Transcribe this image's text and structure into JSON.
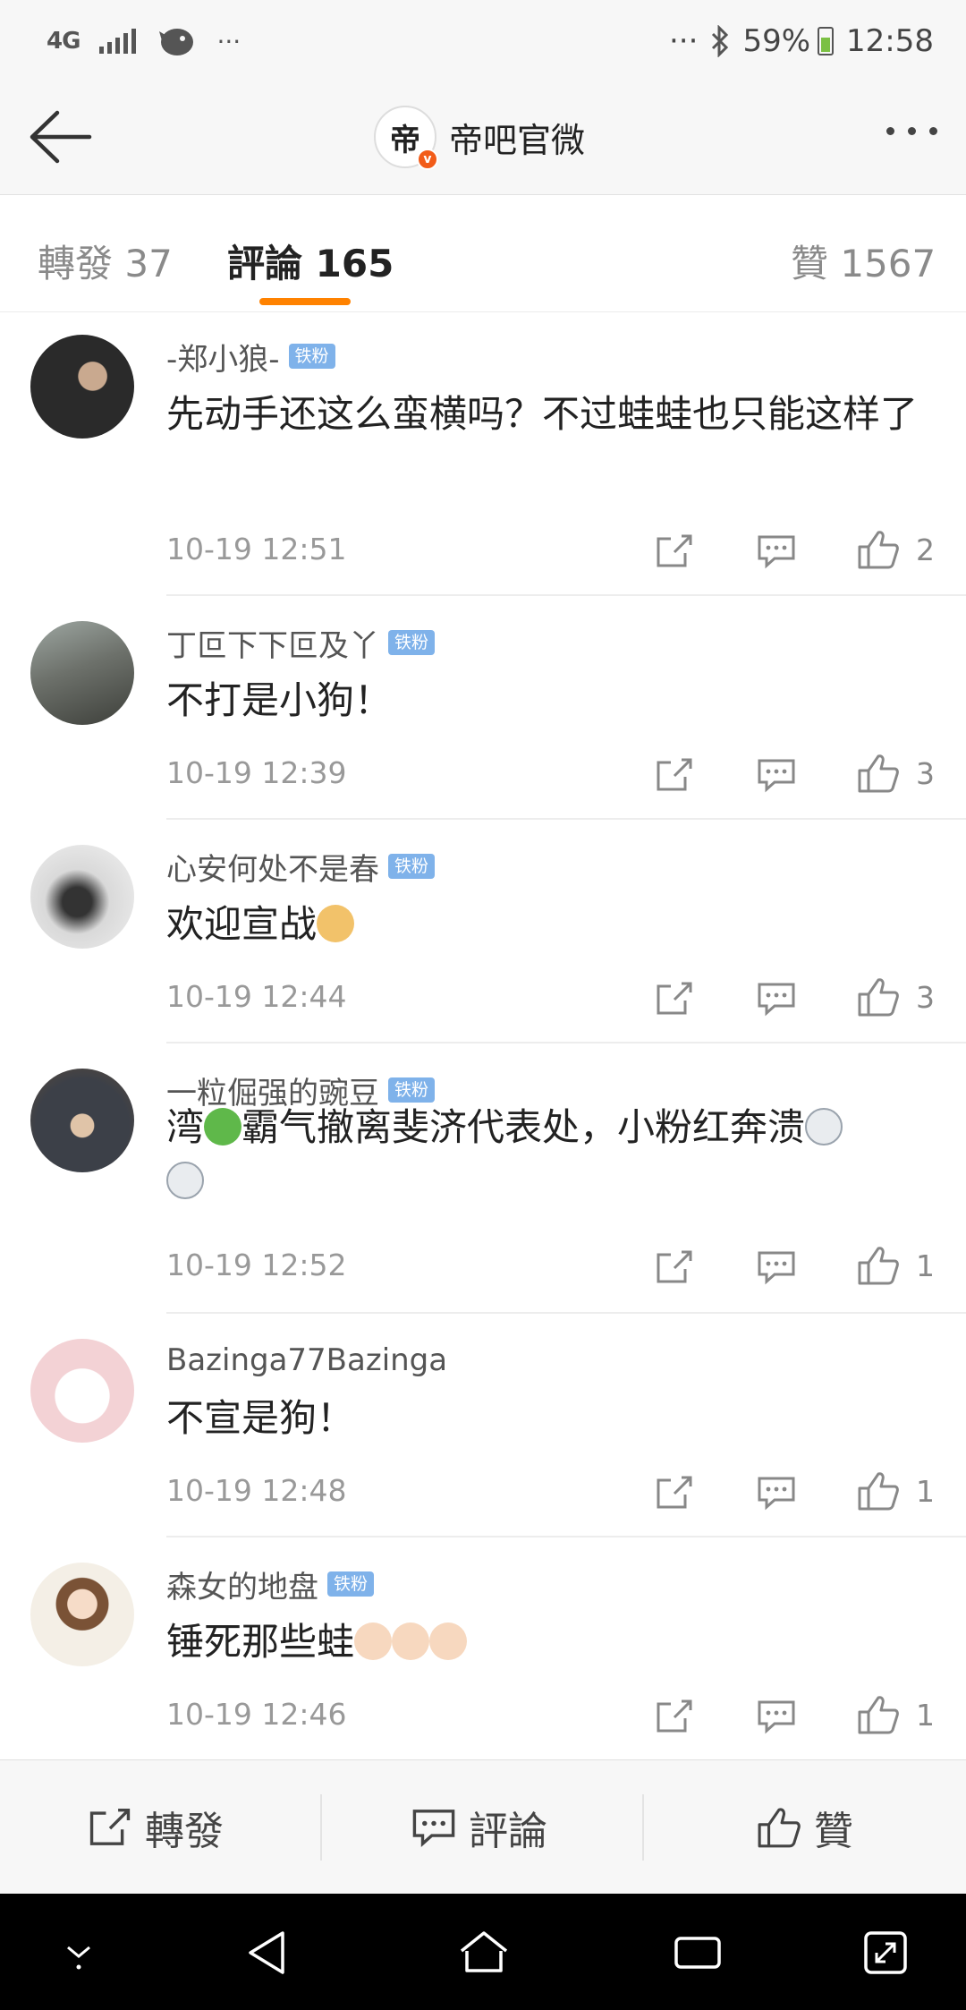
{
  "status_bar": {
    "network": "4G",
    "dots_left": "···",
    "dots_right": "···",
    "battery": "59%",
    "time": "12:58"
  },
  "header": {
    "avatar_char": "帝",
    "title": "帝吧官微"
  },
  "tabs": [
    {
      "label": "轉發 37"
    },
    {
      "label": "評論 165"
    },
    {
      "label": "贊 1567"
    }
  ],
  "comments": [
    {
      "name": "-郑小狼-",
      "badge": "铁粉",
      "text": "先动手还这么蛮横吗？不过蛙蛙也只能这样了",
      "time": "10-19 12:51",
      "likes": "2"
    },
    {
      "name": "丁叵下下叵及丫",
      "badge": "铁粉",
      "text": "不打是小狗！",
      "time": "10-19 12:39",
      "likes": "3"
    },
    {
      "name": "心安何处不是春",
      "badge": "铁粉",
      "text": "欢迎宣战",
      "time": "10-19 12:44",
      "likes": "3"
    },
    {
      "name": "一粒倔强的豌豆",
      "badge": "铁粉",
      "text_a": "湾",
      "text_b": "霸气撤离斐济代表处，小粉红奔溃",
      "time": "10-19 12:52",
      "likes": "1"
    },
    {
      "name": "Bazinga77Bazinga",
      "badge": "",
      "text": "不宣是狗！",
      "time": "10-19 12:48",
      "likes": "1"
    },
    {
      "name": "森女的地盘",
      "badge": "铁粉",
      "text": "锤死那些蛙",
      "time": "10-19 12:46",
      "likes": "1"
    }
  ],
  "bottom_bar": {
    "repost": "轉發",
    "comment": "評論",
    "like": "贊"
  },
  "colors": {
    "accent": "#ff8200",
    "badge": "#7fb2ea",
    "verified": "#f25c19"
  }
}
